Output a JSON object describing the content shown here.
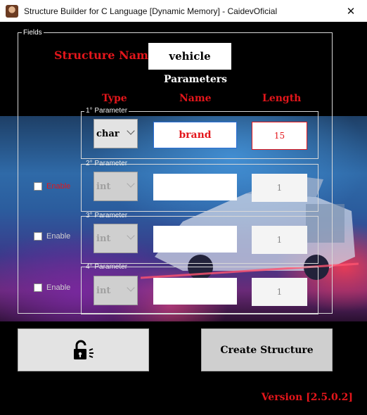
{
  "window": {
    "title": "Structure Builder for C Language [Dynamic Memory] - CaidevOficial",
    "close_glyph": "✕"
  },
  "fields": {
    "legend": "Fields",
    "structure_label": "Structure Name:",
    "structure_name": "vehicle",
    "parameters_title": "Parameters",
    "columns": {
      "type": "Type",
      "name": "Name",
      "length": "Length"
    }
  },
  "parameters": [
    {
      "legend": "1° Parameter",
      "type": "char",
      "name": "brand",
      "length": "15",
      "enabled": true
    },
    {
      "legend": "2° Parameter",
      "type": "int",
      "name": "",
      "length": "1",
      "enabled": false,
      "enable_label": "Enable"
    },
    {
      "legend": "3° Parameter",
      "type": "int",
      "name": "",
      "length": "1",
      "enabled": false,
      "enable_label": "Enable"
    },
    {
      "legend": "4° Parameter",
      "type": "int",
      "name": "",
      "length": "1",
      "enabled": false,
      "enable_label": "Enable"
    }
  ],
  "buttons": {
    "lock_icon": "padlock-open-icon",
    "create_label": "Create Structure"
  },
  "version": "Version [2.5.0.2]",
  "colors": {
    "accent": "#e3161b",
    "active_border": "#2b6fd6"
  }
}
